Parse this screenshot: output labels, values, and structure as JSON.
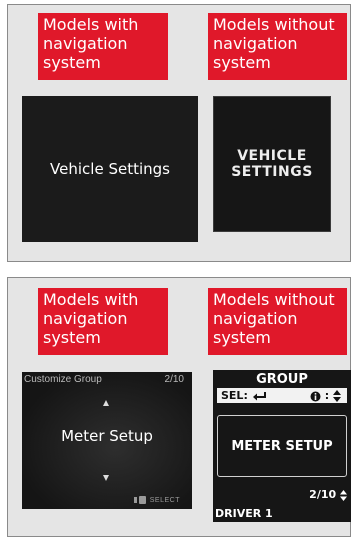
{
  "colors": {
    "tag_red": "#e0182a",
    "panel_bg": "#e5e5e5",
    "screen_bg": "#1b1b1b"
  },
  "panel_top": {
    "tag_nav": [
      "Models with",
      "navigation",
      "system"
    ],
    "tag_nonav": [
      "Models without",
      "navigation",
      "system"
    ],
    "screen_nav_text": "Vehicle Settings",
    "screen_nonav_text": [
      "VEHICLE",
      "SETTINGS"
    ]
  },
  "panel_bottom": {
    "tag_nav": [
      "Models with",
      "navigation",
      "system"
    ],
    "tag_nonav": [
      "Models without",
      "navigation",
      "system"
    ],
    "nav_screen": {
      "header_title": "Customize Group",
      "header_page": "2/10",
      "item": "Meter Setup",
      "select_hint": "SELECT"
    },
    "nonav_screen": {
      "group_title": "GROUP",
      "sel_label": "SEL:",
      "sel_icon": "enter-arrow-icon",
      "info_label": "⬤:",
      "info_icon": "up-down-arrows-icon",
      "item": "METER SETUP",
      "page_count": "2/10",
      "driver": "DRIVER 1"
    }
  }
}
